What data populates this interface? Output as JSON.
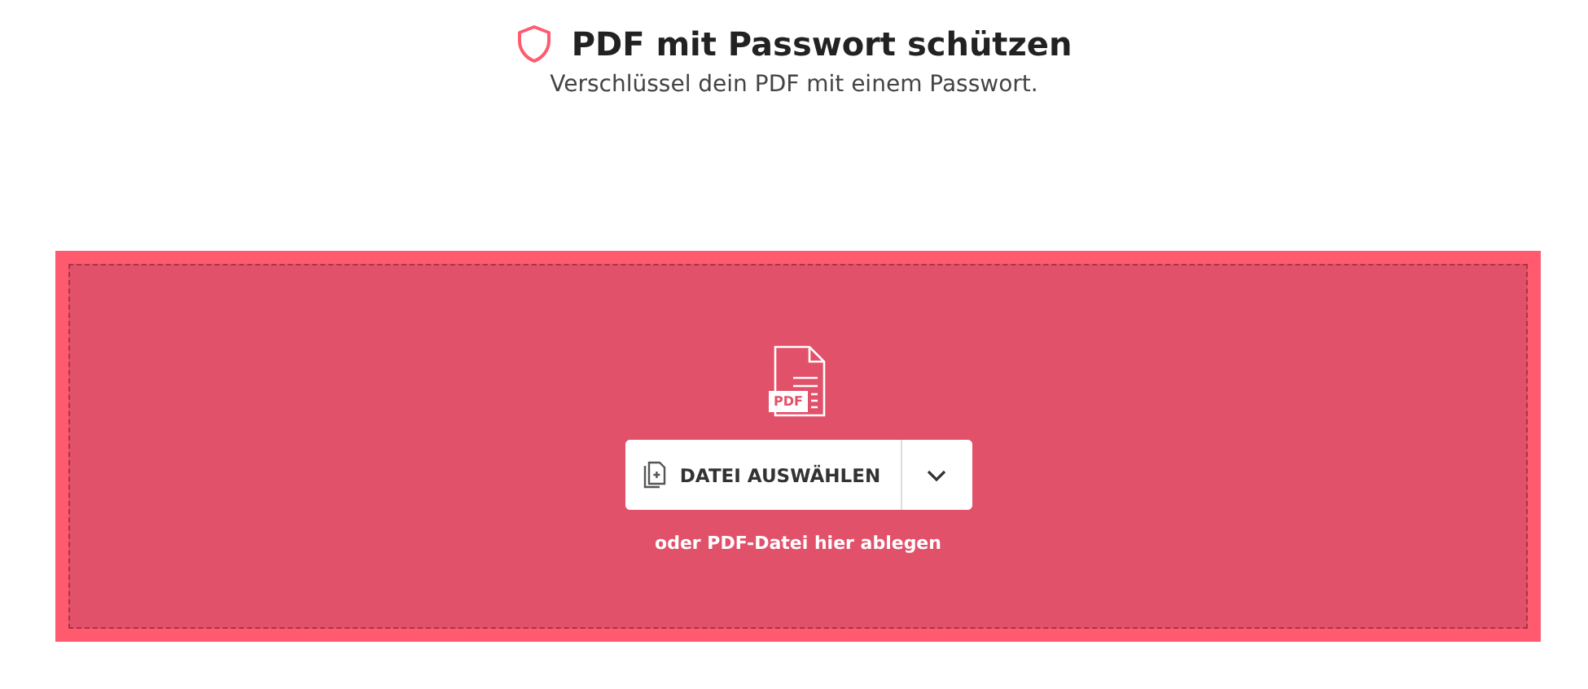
{
  "header": {
    "title": "PDF mit Passwort schützen",
    "subtitle": "Verschlüssel dein PDF mit einem Passwort."
  },
  "dropzone": {
    "file_icon_label": "PDF",
    "button": {
      "label": "DATEI AUSWÄHLEN"
    },
    "hint": "oder PDF-Datei hier ablegen"
  }
}
